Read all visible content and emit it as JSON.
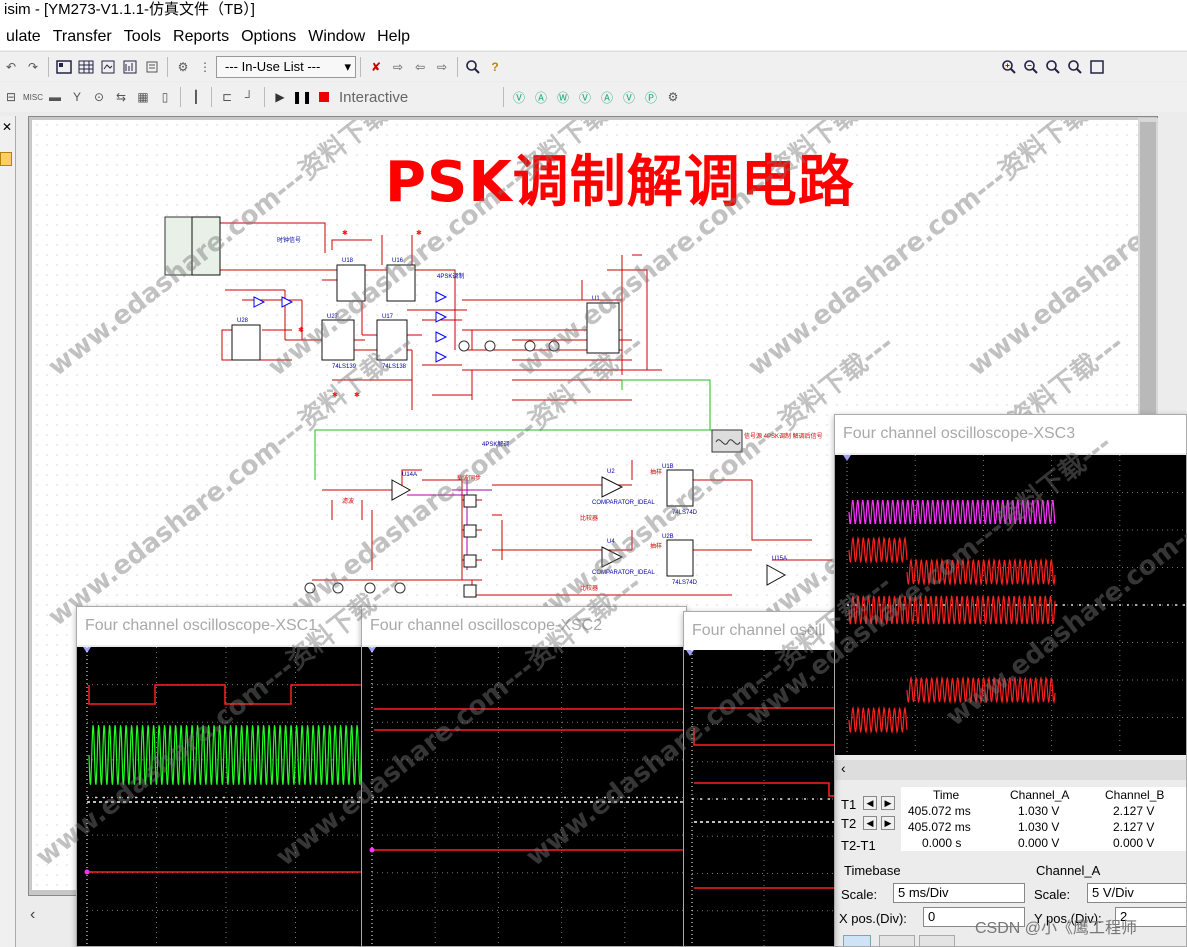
{
  "window": {
    "title": "isim - [YM273-V1.1.1-仿真文件（TB）]"
  },
  "menu": [
    {
      "label": "ulate"
    },
    {
      "label": "Transfer"
    },
    {
      "label": "Tools"
    },
    {
      "label": "Reports"
    },
    {
      "label": "Options"
    },
    {
      "label": "Window"
    },
    {
      "label": "Help"
    }
  ],
  "toolbar": {
    "in_use_list": "--- In-Use List ---",
    "interactive_label": "Interactive",
    "misc_label": "MISC"
  },
  "canvas": {
    "title": "PSK调制解调电路",
    "watermark": "www.edashare.com---资料下载---"
  },
  "oscilloscopes": {
    "xsc3": {
      "title": "Four channel oscilloscope-XSC3"
    },
    "xsc1": {
      "title": "Four channel oscilloscope-XSC1"
    },
    "xsc2": {
      "title": "Four channel oscilloscope-XSC2"
    },
    "xsc4": {
      "title": "Four channel oscill"
    }
  },
  "measurements": {
    "headers": [
      "Time",
      "Channel_A",
      "Channel_B"
    ],
    "rows": [
      {
        "label": "T1",
        "time": "405.072 ms",
        "a": "1.030 V",
        "b": "2.127 V"
      },
      {
        "label": "T2",
        "time": "405.072 ms",
        "a": "1.030 V",
        "b": "2.127 V"
      },
      {
        "label": "T2-T1",
        "time": "0.000 s",
        "a": "0.000 V",
        "b": "0.000 V"
      }
    ]
  },
  "timebase": {
    "label": "Timebase",
    "scale_label": "Scale:",
    "scale_value": "5 ms/Div",
    "xpos_label": "X pos.(Div):",
    "xpos_value": "0"
  },
  "channel_a": {
    "label": "Channel_A",
    "scale_label": "Scale:",
    "scale_value": "5  V/Div",
    "ypos_label": "Y pos.(Div):",
    "ypos_value": "2"
  },
  "csdn_mark": "CSDN @小《鹰工程师",
  "colors": {
    "title_red": "#ff0000",
    "trace_red": "#ff2020",
    "trace_green": "#22ff22",
    "trace_magenta": "#ff33ff",
    "screen_bg": "#000000"
  }
}
